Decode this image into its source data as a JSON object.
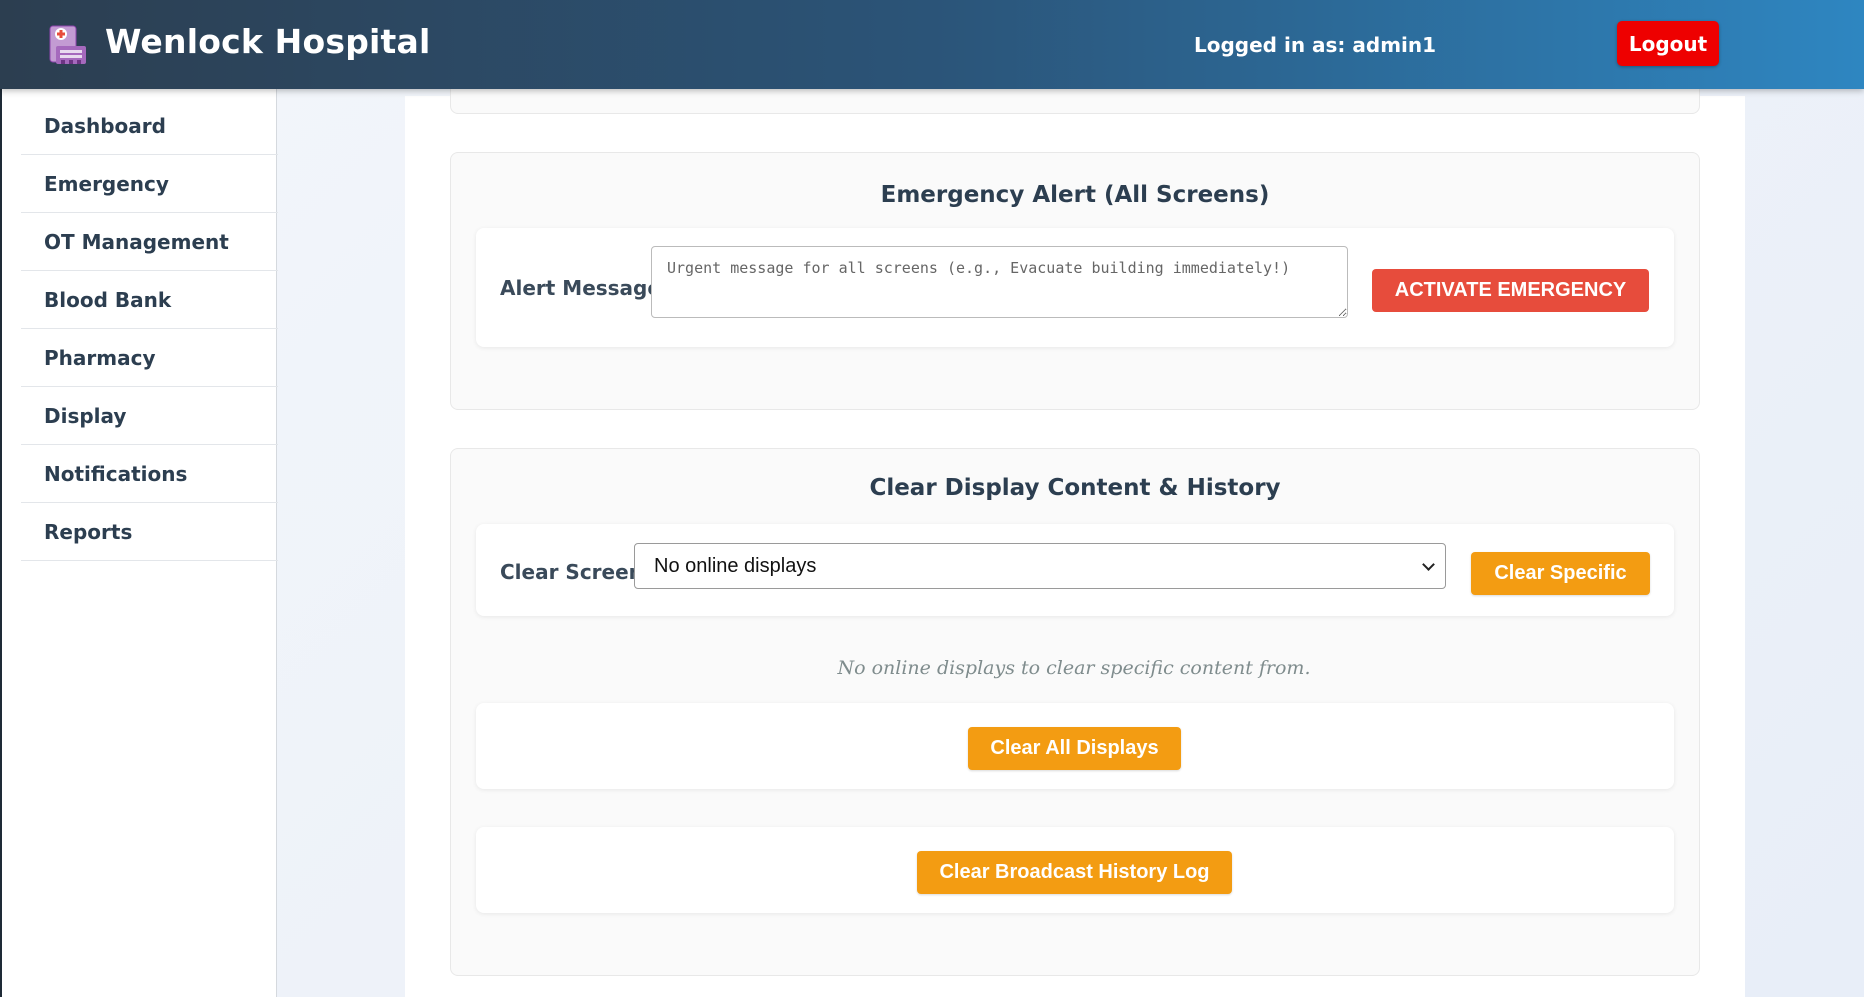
{
  "header": {
    "logo_icon": "hospital-building-icon",
    "title": "Wenlock Hospital",
    "logged_in": "Logged in as: admin1",
    "logout_label": "Logout"
  },
  "sidebar": {
    "items": [
      {
        "label": "Dashboard"
      },
      {
        "label": "Emergency"
      },
      {
        "label": "OT Management"
      },
      {
        "label": "Blood Bank"
      },
      {
        "label": "Pharmacy"
      },
      {
        "label": "Display"
      },
      {
        "label": "Notifications"
      },
      {
        "label": "Reports"
      }
    ]
  },
  "emergency": {
    "title": "Emergency Alert (All Screens)",
    "label": "Alert Message:",
    "placeholder": "Urgent message for all screens (e.g., Evacuate building immediately!)",
    "button": "ACTIVATE EMERGENCY"
  },
  "clear": {
    "title": "Clear Display Content & History",
    "label": "Clear Screen:",
    "selected": "No online displays",
    "specific_button": "Clear Specific",
    "note": "No online displays to clear specific content from.",
    "all_button": "Clear All Displays",
    "history_button": "Clear Broadcast History Log"
  },
  "colors": {
    "header_start": "#2c3e50",
    "header_end": "#2e86c1",
    "logout": "#ee0000",
    "danger": "#e74c3c",
    "warning": "#f39c12"
  }
}
